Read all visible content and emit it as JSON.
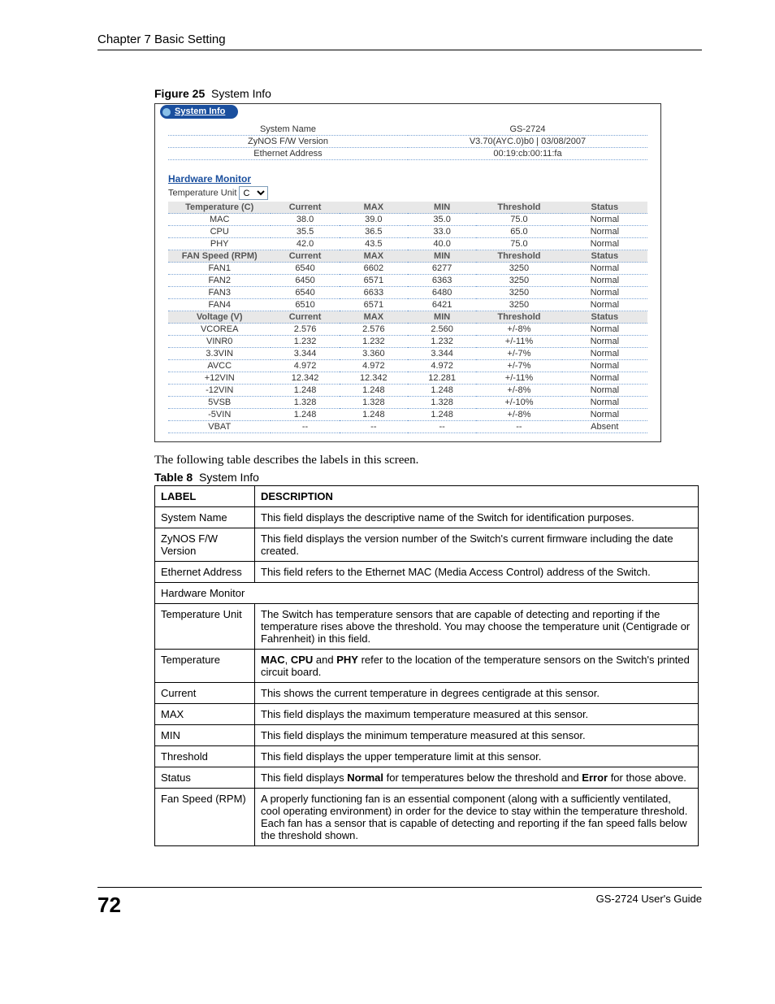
{
  "chapter": "Chapter 7 Basic Setting",
  "figure": {
    "label": "Figure 25",
    "title": "System Info"
  },
  "tab_label": "System Info",
  "sysinfo": [
    {
      "label": "System Name",
      "value": "GS-2724"
    },
    {
      "label": "ZyNOS F/W Version",
      "value": "V3.70(AYC.0)b0 | 03/08/2007"
    },
    {
      "label": "Ethernet Address",
      "value": "00:19:cb:00:11:fa"
    }
  ],
  "hw_section": "Hardware Monitor",
  "temp_unit_label": "Temperature Unit",
  "temp_unit_value": "C",
  "hw_groups": [
    {
      "header": [
        "Temperature (C)",
        "Current",
        "MAX",
        "MIN",
        "Threshold",
        "Status"
      ],
      "rows": [
        [
          "MAC",
          "38.0",
          "39.0",
          "35.0",
          "75.0",
          "Normal"
        ],
        [
          "CPU",
          "35.5",
          "36.5",
          "33.0",
          "65.0",
          "Normal"
        ],
        [
          "PHY",
          "42.0",
          "43.5",
          "40.0",
          "75.0",
          "Normal"
        ]
      ]
    },
    {
      "header": [
        "FAN Speed (RPM)",
        "Current",
        "MAX",
        "MIN",
        "Threshold",
        "Status"
      ],
      "rows": [
        [
          "FAN1",
          "6540",
          "6602",
          "6277",
          "3250",
          "Normal"
        ],
        [
          "FAN2",
          "6450",
          "6571",
          "6363",
          "3250",
          "Normal"
        ],
        [
          "FAN3",
          "6540",
          "6633",
          "6480",
          "3250",
          "Normal"
        ],
        [
          "FAN4",
          "6510",
          "6571",
          "6421",
          "3250",
          "Normal"
        ]
      ]
    },
    {
      "header": [
        "Voltage (V)",
        "Current",
        "MAX",
        "MIN",
        "Threshold",
        "Status"
      ],
      "rows": [
        [
          "VCOREA",
          "2.576",
          "2.576",
          "2.560",
          "+/-8%",
          "Normal"
        ],
        [
          "VINR0",
          "1.232",
          "1.232",
          "1.232",
          "+/-11%",
          "Normal"
        ],
        [
          "3.3VIN",
          "3.344",
          "3.360",
          "3.344",
          "+/-7%",
          "Normal"
        ],
        [
          "AVCC",
          "4.972",
          "4.972",
          "4.972",
          "+/-7%",
          "Normal"
        ],
        [
          "+12VIN",
          "12.342",
          "12.342",
          "12.281",
          "+/-11%",
          "Normal"
        ],
        [
          "-12VIN",
          "1.248",
          "1.248",
          "1.248",
          "+/-8%",
          "Normal"
        ],
        [
          "5VSB",
          "1.328",
          "1.328",
          "1.328",
          "+/-10%",
          "Normal"
        ],
        [
          "-5VIN",
          "1.248",
          "1.248",
          "1.248",
          "+/-8%",
          "Normal"
        ],
        [
          "VBAT",
          "--",
          "--",
          "--",
          "--",
          "Absent"
        ]
      ]
    }
  ],
  "body_text": "The following table describes the labels in this screen.",
  "table_caption": {
    "label": "Table 8",
    "title": "System Info"
  },
  "desc_header": {
    "c1": "LABEL",
    "c2": "DESCRIPTION"
  },
  "desc_rows": [
    {
      "label": "System Name",
      "desc": "This field displays the descriptive name of the Switch for identification purposes."
    },
    {
      "label": "ZyNOS F/W Version",
      "desc": "This field displays the version number of the Switch's current firmware including the date created."
    },
    {
      "label": "Ethernet Address",
      "desc": "This field refers to the Ethernet MAC (Media Access Control) address of the Switch."
    },
    {
      "label": "Hardware Monitor",
      "desc": "",
      "span": true
    },
    {
      "label": "Temperature Unit",
      "desc": "The Switch has temperature sensors that are capable of detecting and reporting if the temperature rises above the threshold. You may choose the temperature unit (Centigrade or Fahrenheit) in this field."
    },
    {
      "label": "Temperature",
      "desc_html": "<b>MAC</b>, <b>CPU</b> and <b>PHY</b> refer to the location of the temperature sensors on the Switch's printed circuit board."
    },
    {
      "label": "Current",
      "desc": "This shows the current temperature in degrees centigrade at this sensor."
    },
    {
      "label": "MAX",
      "desc": "This field displays the maximum temperature measured at this sensor."
    },
    {
      "label": "MIN",
      "desc": "This field displays the minimum temperature measured at this sensor."
    },
    {
      "label": "Threshold",
      "desc": "This field displays the upper temperature limit at this sensor."
    },
    {
      "label": "Status",
      "desc_html": "This field displays <b>Normal</b> for temperatures below the threshold and <b>Error</b> for those above."
    },
    {
      "label": "Fan Speed (RPM)",
      "desc": "A properly functioning fan is an essential component (along with a sufficiently ventilated, cool operating environment) in order for the device to stay within the temperature threshold. Each fan has a sensor that is capable of detecting and reporting if the fan speed falls below the threshold shown."
    }
  ],
  "page_number": "72",
  "guide": "GS-2724 User's Guide"
}
